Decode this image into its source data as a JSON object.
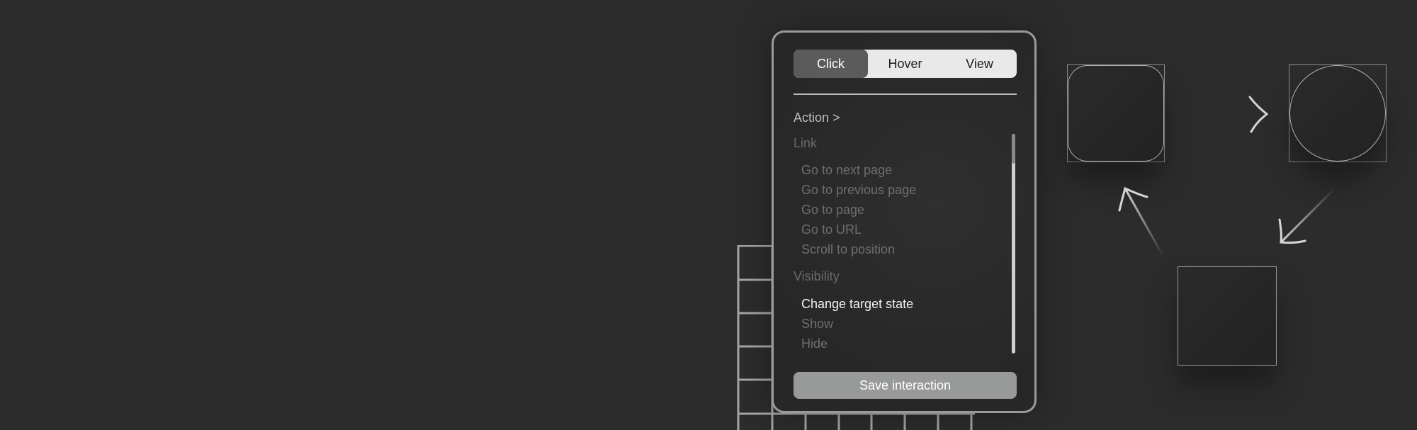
{
  "tabs": [
    {
      "label": "Click",
      "active": true
    },
    {
      "label": "Hover",
      "active": false
    },
    {
      "label": "View",
      "active": false
    }
  ],
  "action_label": "Action >",
  "groups": {
    "link": {
      "label": "Link",
      "items": [
        "Go to next page",
        "Go to previous page",
        "Go to page",
        "Go to URL",
        "Scroll to position"
      ]
    },
    "visibility": {
      "label": "Visibility",
      "items": [
        "Change target state",
        "Show",
        "Hide"
      ],
      "highlighted_item": "Change target state"
    }
  },
  "save_button_label": "Save interaction",
  "colors": {
    "background": "#2c2c2c",
    "panel_border": "#9a9a9a",
    "tab_active": "#5b5b5b",
    "save_button": "#989a99"
  }
}
